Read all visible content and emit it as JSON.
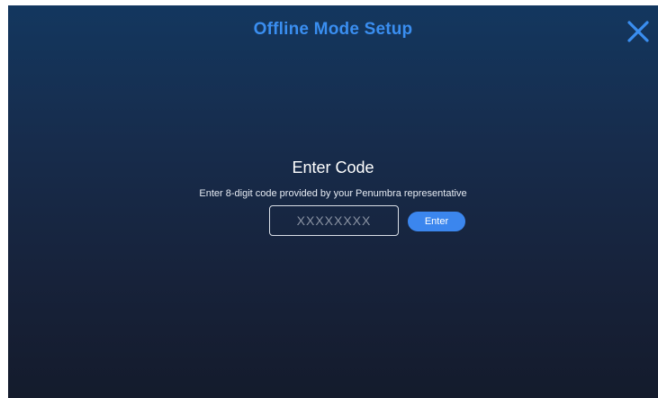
{
  "header": {
    "title": "Offline Mode Setup",
    "close_icon": "close-icon"
  },
  "main": {
    "heading": "Enter Code",
    "instruction": "Enter 8-digit code provided by your Penumbra representative",
    "code_input": {
      "value": "",
      "placeholder": "XXXXXXXX"
    },
    "enter_label": "Enter"
  },
  "colors": {
    "accent": "#3a8ef0",
    "button": "#3b86ee",
    "background_top": "#13375f",
    "background_bottom": "#141b2c"
  }
}
